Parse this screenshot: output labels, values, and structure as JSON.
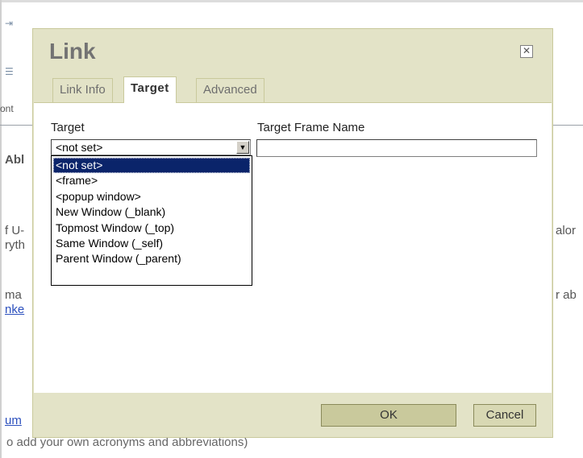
{
  "background": {
    "side_texts": [
      "ont",
      "Abl",
      "f U-",
      "ryth",
      "ma",
      "nke",
      "um"
    ],
    "right_texts": [
      "alor",
      "r ab"
    ],
    "bottom_text": "o add your own acronyms and abbreviations)"
  },
  "dialog": {
    "title": "Link",
    "close_glyph": "✕",
    "tabs": [
      {
        "label": "Link Info"
      },
      {
        "label": "Target"
      },
      {
        "label": "Advanced"
      }
    ],
    "target_label": "Target",
    "target_selected": "<not set>",
    "frame_name_label": "Target Frame Name",
    "frame_name_value": "",
    "options": [
      "<not set>",
      "<frame>",
      "<popup window>",
      "New Window (_blank)",
      "Topmost Window (_top)",
      "Same Window (_self)",
      "Parent Window (_parent)"
    ],
    "ok_label": "OK",
    "cancel_label": "Cancel"
  },
  "colors": {
    "dialog_bg": "#e3e3c7",
    "button_bg": "#c9c99c",
    "selected_option_bg": "#0a246a"
  }
}
